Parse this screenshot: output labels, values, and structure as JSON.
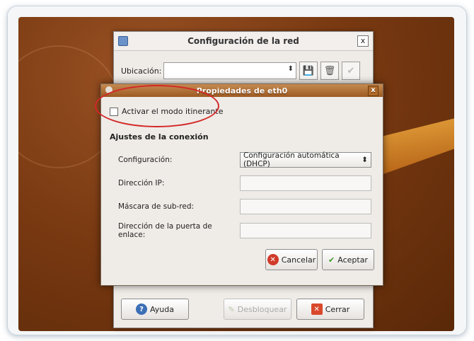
{
  "network_window": {
    "title": "Configuración de la red",
    "close_glyph": "x",
    "location_label": "Ubicación:",
    "location_value": "",
    "buttons": {
      "help": "Ayuda",
      "unlock": "Desbloquear",
      "close": "Cerrar"
    },
    "icons": [
      "save-icon",
      "delete-icon",
      "apply-icon"
    ]
  },
  "properties_dialog": {
    "title": "Propiedades de eth0",
    "close_glyph": "x",
    "roaming_checkbox_label": "Activar el modo itinerante",
    "roaming_checked": false,
    "section_title": "Ajustes de la conexión",
    "fields": {
      "config_label": "Configuración:",
      "config_value": "Configuración automática (DHCP)",
      "ip_label": "Dirección IP:",
      "ip_value": "",
      "mask_label": "Máscara de sub-red:",
      "mask_value": "",
      "gateway_label": "Dirección de la puerta de enlace:",
      "gateway_value": ""
    },
    "buttons": {
      "cancel": "Cancelar",
      "accept": "Aceptar"
    }
  },
  "annotation_color": "#d32828"
}
